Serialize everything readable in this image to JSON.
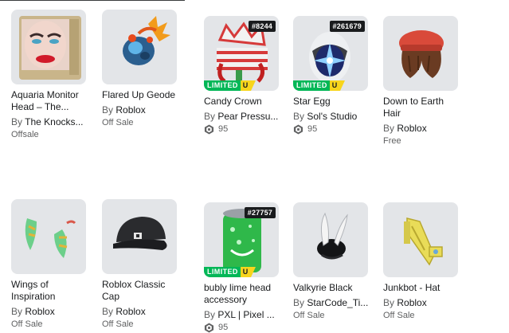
{
  "items": [
    {
      "name": "Aquaria Monitor Head – The...",
      "by": "By",
      "creator": "The Knocks...",
      "price": "Offsale",
      "serial": "",
      "limited": false
    },
    {
      "name": "Flared Up Geode",
      "by": "By",
      "creator": "Roblox",
      "price": "Off Sale",
      "serial": "",
      "limited": false
    },
    {
      "name": "Candy Crown",
      "by": "By",
      "creator": "Pear Pressu...",
      "price": "95",
      "serial": "#8244",
      "limited": true
    },
    {
      "name": "Star Egg",
      "by": "By",
      "creator": "Sol's Studio",
      "price": "95",
      "serial": "#261679",
      "limited": true
    },
    {
      "name": "Down to Earth Hair",
      "by": "By",
      "creator": "Roblox",
      "price": "Free",
      "serial": "",
      "limited": false
    },
    {
      "name": "Wings of Inspiration",
      "by": "By",
      "creator": "Roblox",
      "price": "Off Sale",
      "serial": "",
      "limited": false
    },
    {
      "name": "Roblox Classic Cap",
      "by": "By",
      "creator": "Roblox",
      "price": "Off Sale",
      "serial": "",
      "limited": false
    },
    {
      "name": "bubly lime head accessory",
      "by": "By",
      "creator": "PXL | Pixel ...",
      "price": "95",
      "serial": "#27757",
      "limited": true
    },
    {
      "name": "Valkyrie Black",
      "by": "By",
      "creator": "StarCode_Ti...",
      "price": "Off Sale",
      "serial": "",
      "limited": false
    },
    {
      "name": "Junkbot - Hat",
      "by": "By",
      "creator": "Roblox",
      "price": "Off Sale",
      "serial": "",
      "limited": false
    }
  ],
  "badges": {
    "limited": "LIMITED",
    "unique": "U"
  },
  "icons": {
    "currency": "robux-icon"
  },
  "colors": {
    "limited_green": "#02b757",
    "unique_yellow": "#f8d51c",
    "tile_bg": "#e3e5e8"
  }
}
